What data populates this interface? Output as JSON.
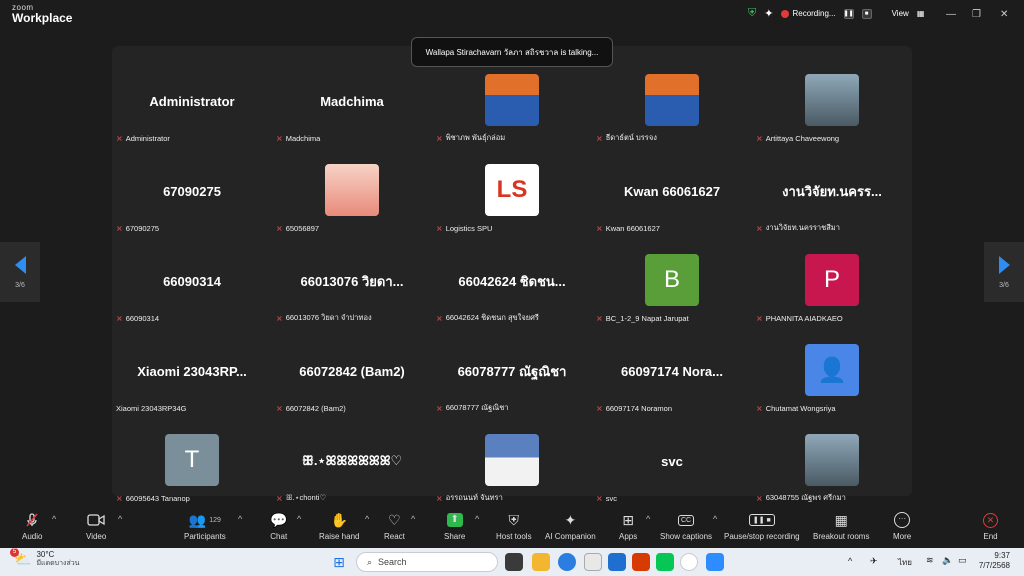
{
  "app": {
    "brand_top": "zoom",
    "brand_bottom": "Workplace"
  },
  "titlebar": {
    "recording_label": "Recording...",
    "view_label": "View"
  },
  "talking_tooltip": "Wallapa Stirachavarn วัลภา สถิรชวาล is talking...",
  "pager": {
    "left_label": "3/6",
    "right_label": "3/6"
  },
  "colors": {
    "accent": "#2e8cf2",
    "muted_mic": "#e03a3a",
    "stage": "#242424"
  },
  "tiles": [
    {
      "big": "Administrator",
      "name": "Administrator"
    },
    {
      "big": "Madchima",
      "name": "Madchima"
    },
    {
      "pic": "photo-student-icon",
      "name": "พิชาภพ พันธุ์กล่อม"
    },
    {
      "pic": "photo-student-icon",
      "name": "ธีดาธ์ตน์ บรรจง"
    },
    {
      "pic": "photo-person-icon",
      "name": "Artittaya Chaveewong"
    },
    {
      "big": "67090275",
      "name": "67090275"
    },
    {
      "pic": "anime-avatar-icon",
      "name": "65056897"
    },
    {
      "pic": "logistics-logo-icon",
      "name": "Logistics SPU"
    },
    {
      "big": "Kwan 66061627",
      "name": "Kwan 66061627"
    },
    {
      "big": "งานวิจัยท.นครร...",
      "name": "งานวิจัยท.นครราชสีมา"
    },
    {
      "big": "66090314",
      "name": "66090314"
    },
    {
      "big": "66013076 วิยดา...",
      "name": "66013076 วิยดา จำปาทอง"
    },
    {
      "big": "66042624 ชิดชน...",
      "name": "66042624 ชิดชนก สุขใจยศรี"
    },
    {
      "letter": "B",
      "color": "#5a9e3a",
      "name": "BC_1-2_9 Napat Jarupat"
    },
    {
      "letter": "P",
      "color": "#c8174f",
      "name": "PHANNITA AIADKAEO"
    },
    {
      "big": "Xiaomi  23043RP...",
      "name": "Xiaomi 23043RP34G",
      "unmuted": true
    },
    {
      "big": "66072842 (Bam2)",
      "name": "66072842 (Bam2)"
    },
    {
      "big": "66078777 ณัฐณิชา",
      "name": "66078777 ณัฐณิชา"
    },
    {
      "big": "66097174  Nora...",
      "name": "66097174 Noramon"
    },
    {
      "pic": "default-user-icon",
      "name": "Chutamat Wongsriya"
    },
    {
      "letter": "T",
      "color": "#7a8f9a",
      "name": "66095643 Tananop"
    },
    {
      "big": "ꕥ.⋆ꕤꕤꕤꕤꕤꕤ♡",
      "name": "ꕥ.⋆chonti♡"
    },
    {
      "pic": "photo-uniform-icon",
      "name": "อรรถนนท์ จันทรา"
    },
    {
      "big": "svc",
      "name": "svc"
    },
    {
      "pic": "photo-person-icon",
      "name": "63048755 ณัฐพร ศรีกมา"
    }
  ],
  "toolbar": {
    "audio": "Audio",
    "video": "Video",
    "participants": "Participants",
    "participants_count": "129",
    "chat": "Chat",
    "raise_hand": "Raise hand",
    "react": "React",
    "share": "Share",
    "host_tools": "Host tools",
    "ai_companion": "AI Companion",
    "apps": "Apps",
    "show_captions": "Show captions",
    "pause_recording": "Pause/stop recording",
    "breakout_rooms": "Breakout rooms",
    "more": "More",
    "end": "End"
  },
  "taskbar": {
    "weather_temp": "30°C",
    "weather_desc": "มีแดดบางส่วน",
    "weather_badge": "5",
    "search_placeholder": "Search",
    "language": "ไทย",
    "time": "9:37",
    "date": "7/7/2568"
  }
}
